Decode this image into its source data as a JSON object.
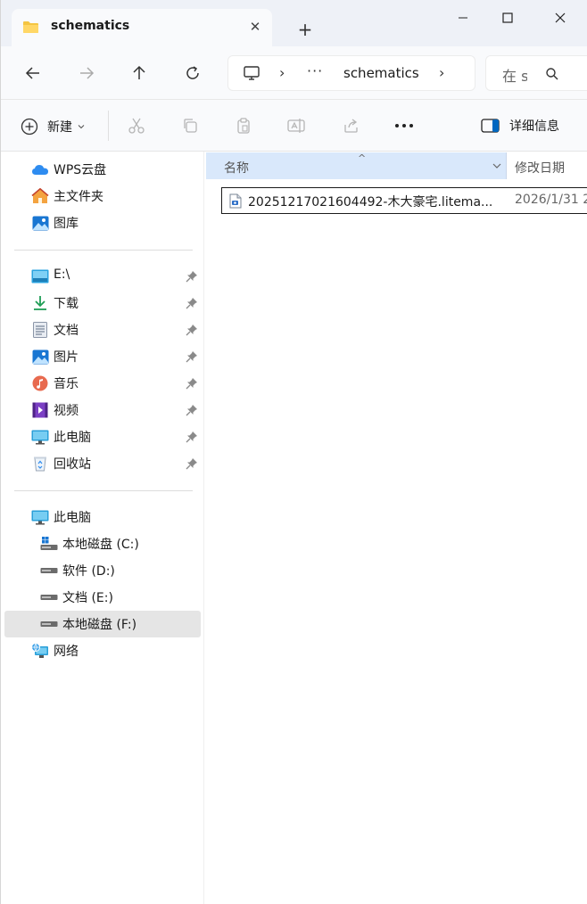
{
  "tab": {
    "title": "schematics",
    "close_symbol": "✕"
  },
  "newtab_symbol": "+",
  "address": {
    "separator": "›",
    "ellipsis": "···",
    "current": "schematics"
  },
  "search": {
    "placeholder": "在 s"
  },
  "toolbar": {
    "new_label": "新建",
    "details_label": "详细信息"
  },
  "sidebar": {
    "quick": [
      {
        "label": "WPS云盘",
        "icon": "cloud-icon"
      },
      {
        "label": "主文件夹",
        "icon": "home-icon"
      },
      {
        "label": "图库",
        "icon": "gallery-icon"
      }
    ],
    "pinned": [
      {
        "label": "E:\\",
        "icon": "drive-icon"
      },
      {
        "label": "下载",
        "icon": "download-icon"
      },
      {
        "label": "文档",
        "icon": "document-icon"
      },
      {
        "label": "图片",
        "icon": "pictures-icon"
      },
      {
        "label": "音乐",
        "icon": "music-icon"
      },
      {
        "label": "视频",
        "icon": "video-icon"
      },
      {
        "label": "此电脑",
        "icon": "computer-icon"
      },
      {
        "label": "回收站",
        "icon": "recycle-bin-icon"
      }
    ],
    "tree": [
      {
        "label": "此电脑",
        "icon": "computer-icon"
      },
      {
        "label": "本地磁盘 (C:)",
        "icon": "system-drive-icon"
      },
      {
        "label": "软件 (D:)",
        "icon": "hard-drive-icon"
      },
      {
        "label": "文档 (E:)",
        "icon": "hard-drive-icon"
      },
      {
        "label": "本地磁盘 (F:)",
        "icon": "hard-drive-icon"
      },
      {
        "label": "网络",
        "icon": "network-icon"
      }
    ]
  },
  "columns": {
    "name": "名称",
    "date": "修改日期",
    "sort_caret": "^"
  },
  "files": [
    {
      "name": "20251217021604492-木大豪宅.litema...",
      "date": "2026/1/31 2"
    }
  ],
  "colors": {
    "accent": "#0067c0",
    "selected_header": "#d9e8fb",
    "folder": "#f4c542"
  }
}
